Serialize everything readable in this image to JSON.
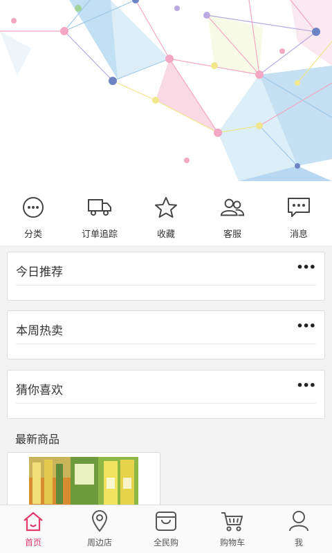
{
  "quick_nav": [
    {
      "label": "分类",
      "icon": "category-icon"
    },
    {
      "label": "订单追踪",
      "icon": "truck-icon"
    },
    {
      "label": "收藏",
      "icon": "star-icon"
    },
    {
      "label": "客服",
      "icon": "customer-service-icon"
    },
    {
      "label": "消息",
      "icon": "message-icon"
    }
  ],
  "sections": [
    {
      "title": "今日推荐",
      "more": "•••"
    },
    {
      "title": "本周热卖",
      "more": "•••"
    },
    {
      "title": "猜你喜欢",
      "more": "•••"
    }
  ],
  "latest": {
    "title": "最新商品"
  },
  "tabs": [
    {
      "label": "首页",
      "icon": "home-icon",
      "active": true
    },
    {
      "label": "周边店",
      "icon": "location-pin-icon",
      "active": false
    },
    {
      "label": "全民购",
      "icon": "shopping-bag-icon",
      "active": false
    },
    {
      "label": "购物车",
      "icon": "cart-icon",
      "active": false
    },
    {
      "label": "我",
      "icon": "user-icon",
      "active": false
    }
  ],
  "colors": {
    "accent": "#e4386a",
    "icon": "#444444",
    "background": "#f3f3f3"
  }
}
